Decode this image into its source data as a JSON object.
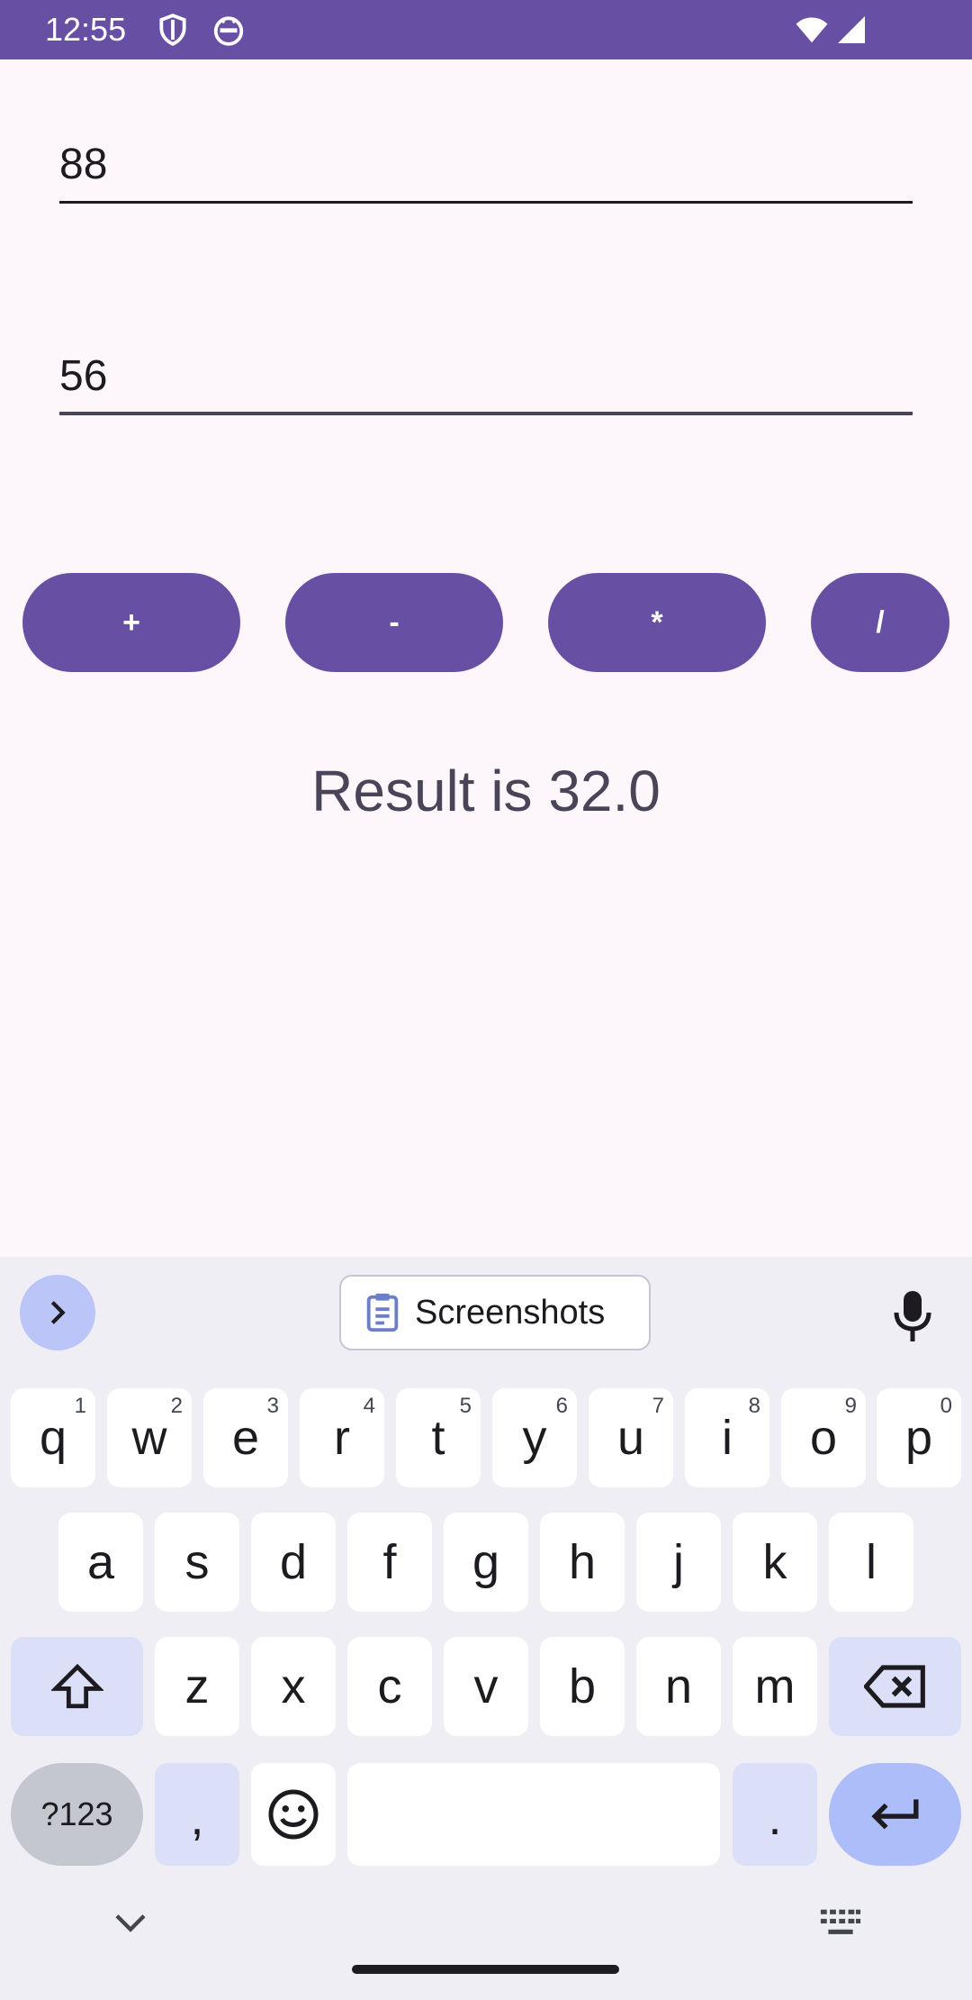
{
  "status_bar": {
    "time": "12:55",
    "icons": [
      "shield-icon",
      "robot-face-icon",
      "wifi-icon",
      "signal-icon"
    ],
    "background": "#6750a4"
  },
  "calculator": {
    "first_value": "88",
    "second_value": "56",
    "buttons": [
      "+",
      "-",
      "*",
      "/"
    ],
    "result_text": "Result is 32.0",
    "accent": "#6750a4"
  },
  "keyboard": {
    "suggestion_chip": "Screenshots",
    "row1": [
      {
        "key": "q",
        "hint": "1"
      },
      {
        "key": "w",
        "hint": "2"
      },
      {
        "key": "e",
        "hint": "3"
      },
      {
        "key": "r",
        "hint": "4"
      },
      {
        "key": "t",
        "hint": "5"
      },
      {
        "key": "y",
        "hint": "6"
      },
      {
        "key": "u",
        "hint": "7"
      },
      {
        "key": "i",
        "hint": "8"
      },
      {
        "key": "o",
        "hint": "9"
      },
      {
        "key": "p",
        "hint": "0"
      }
    ],
    "row2": [
      "a",
      "s",
      "d",
      "f",
      "g",
      "h",
      "j",
      "k",
      "l"
    ],
    "row3": [
      "z",
      "x",
      "c",
      "v",
      "b",
      "n",
      "m"
    ],
    "symbols_label": "?123",
    "comma": ",",
    "period": "."
  }
}
